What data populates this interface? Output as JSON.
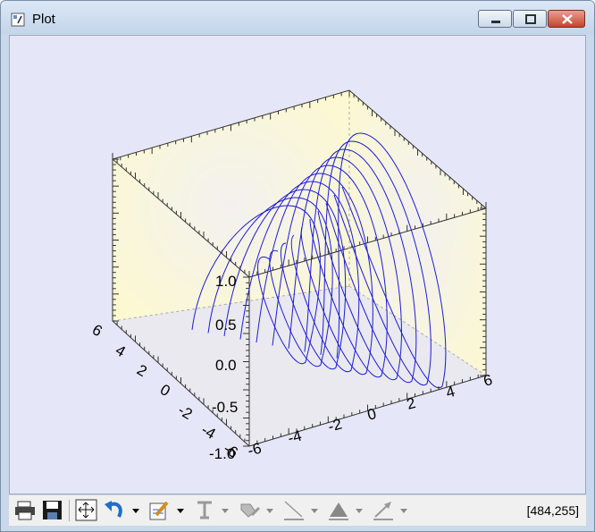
{
  "window": {
    "title": "Plot"
  },
  "plot": {
    "z_ticks": [
      "1.0",
      "0.5",
      "0.0",
      "-0.5",
      "-1.0"
    ],
    "y_ticks": [
      "6",
      "4",
      "2",
      "0",
      "-2",
      "-4",
      "-6"
    ],
    "x_ticks": [
      "-6",
      "-4",
      "-2",
      "0",
      "2",
      "4",
      "6"
    ]
  },
  "toolbar": {
    "icons": [
      "print-icon",
      "save-icon",
      "select-arrow-icon",
      "undo-icon",
      "undo-dropdown-icon",
      "annotate-pencil-icon",
      "pencil-dropdown-icon",
      "text-icon",
      "text-dropdown-icon",
      "fill-icon",
      "fill-dropdown-icon",
      "line-icon",
      "line-dropdown-icon",
      "polygon-icon",
      "polygon-dropdown-icon",
      "arrow-icon",
      "arrow-dropdown-icon"
    ],
    "status": "[484,255]"
  },
  "colors": {
    "curve": "#1c1cd8",
    "background": "#e6e6f9",
    "panel": "#fdf9cf"
  }
}
